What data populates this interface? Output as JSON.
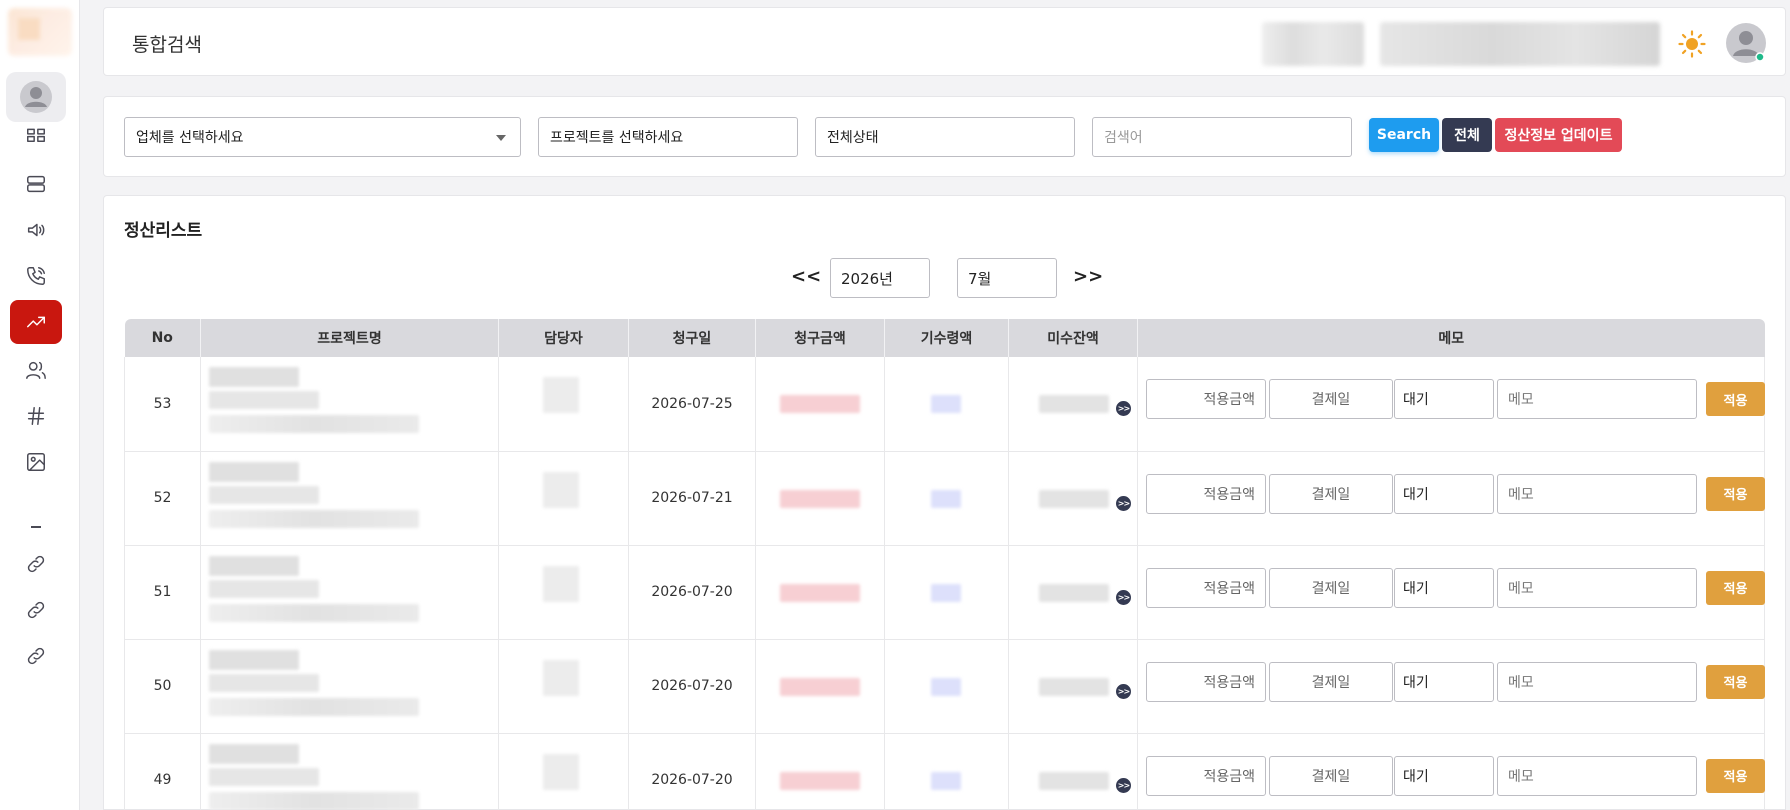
{
  "header": {
    "title": "통합검색"
  },
  "filters": {
    "company_placeholder": "업체를 선택하세요",
    "project_value": "프로젝트를 선택하세요",
    "status_value": "전체상태",
    "search_placeholder": "검색어",
    "search_button": "Search",
    "all_button": "전체",
    "update_button": "정산정보 업데이트"
  },
  "main": {
    "title": "정산리스트",
    "pager": {
      "prev": "<<",
      "next": ">>",
      "year": "2026년",
      "month": "7월"
    },
    "columns": [
      "No",
      "프로젝트명",
      "담당자",
      "청구일",
      "청구금액",
      "기수령액",
      "미수잔액",
      "메모"
    ],
    "rows": [
      {
        "no": "53",
        "date": "2026-07-25",
        "amount_label": "적용금액",
        "pay_date_label": "결제일",
        "status": "대기",
        "memo_placeholder": "메모",
        "apply": "적용"
      },
      {
        "no": "52",
        "date": "2026-07-21",
        "amount_label": "적용금액",
        "pay_date_label": "결제일",
        "status": "대기",
        "memo_placeholder": "메모",
        "apply": "적용"
      },
      {
        "no": "51",
        "date": "2026-07-20",
        "amount_label": "적용금액",
        "pay_date_label": "결제일",
        "status": "대기",
        "memo_placeholder": "메모",
        "apply": "적용"
      },
      {
        "no": "50",
        "date": "2026-07-20",
        "amount_label": "적용금액",
        "pay_date_label": "결제일",
        "status": "대기",
        "memo_placeholder": "메모",
        "apply": "적용"
      },
      {
        "no": "49",
        "date": "2026-07-20",
        "amount_label": "적용금액",
        "pay_date_label": "결제일",
        "status": "대기",
        "memo_placeholder": "메모",
        "apply": "적용"
      }
    ],
    "balance_badge": ">>"
  },
  "sidebar": {
    "items": [
      {
        "icon": "dashboard-icon"
      },
      {
        "icon": "server-icon"
      },
      {
        "icon": "speaker-icon"
      },
      {
        "icon": "phone-icon"
      },
      {
        "icon": "trending-up-icon",
        "active": true
      },
      {
        "icon": "users-icon"
      },
      {
        "icon": "hash-icon"
      },
      {
        "icon": "image-icon"
      },
      {
        "icon": "link-icon"
      },
      {
        "icon": "link-icon"
      },
      {
        "icon": "link-icon"
      }
    ]
  },
  "colors": {
    "accent_red": "#c9170f",
    "search_blue": "#1e9cef",
    "all_navy": "#343a52",
    "update_red": "#e34a57",
    "apply_orange": "#e0a03e"
  }
}
